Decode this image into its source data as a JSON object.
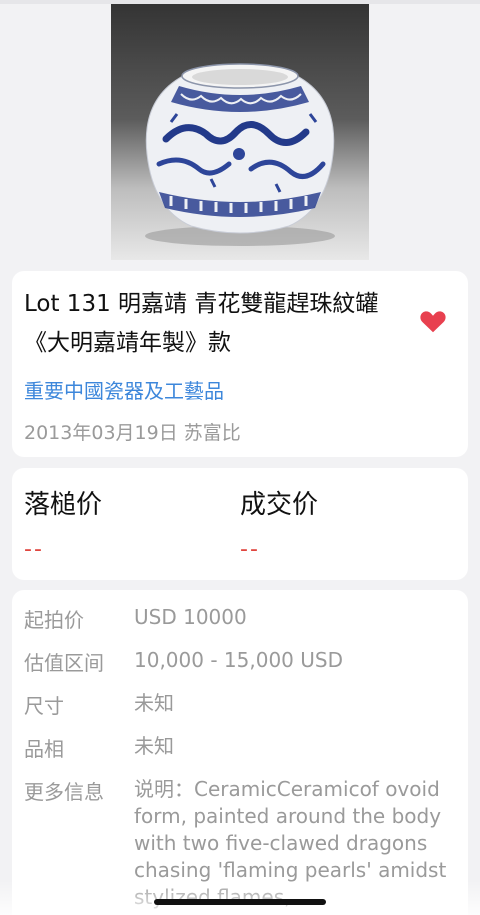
{
  "lot": {
    "image_alt": "Blue and white porcelain jar with dragons",
    "title": "Lot 131 明嘉靖 青花雙龍趕珠紋罐 《大明嘉靖年製》款",
    "category": "重要中國瓷器及工藝品",
    "date_house": "2013年03月19日 苏富比",
    "favorite_icon": "heart-icon",
    "favorite_color": "#e8404f"
  },
  "prices": {
    "hammer_label": "落槌价",
    "hammer_value": "--",
    "deal_label": "成交价",
    "deal_value": "--",
    "value_color": "#e0463f"
  },
  "details": {
    "start_label": "起拍价",
    "start_value": "USD 10000",
    "estimate_label": "估值区间",
    "estimate_value": "10,000 - 15,000 USD",
    "size_label": "尺寸",
    "size_value": "未知",
    "condition_label": "品相",
    "condition_value": "未知",
    "more_label": "更多信息",
    "more_value": "说明：CeramicCeramicof ovoid form, painted around the body with two five-clawed dragons chasing 'flaming pearls' amidst stylized flames,"
  },
  "colors": {
    "link": "#3d87db",
    "muted": "#9a9a9a"
  }
}
